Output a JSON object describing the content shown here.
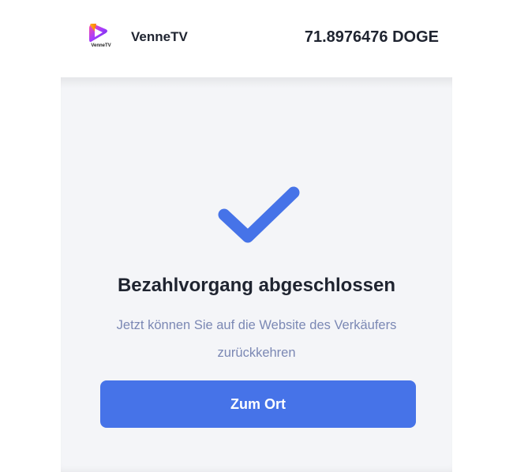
{
  "header": {
    "logo_text": "VenneTV",
    "merchant_name": "VenneTV",
    "balance": "71.8976476 DOGE"
  },
  "status": {
    "icon": "checkmark-icon",
    "title": "Bezahlvorgang abgeschlossen",
    "message": "Jetzt können Sie auf die Website des Verkäufers zurückkehren"
  },
  "actions": {
    "return_label": "Zum Ort"
  },
  "colors": {
    "accent": "#4673e8",
    "card_background": "#f4f5f8",
    "text_dark": "#1f2430",
    "text_muted": "#7b88b4"
  }
}
